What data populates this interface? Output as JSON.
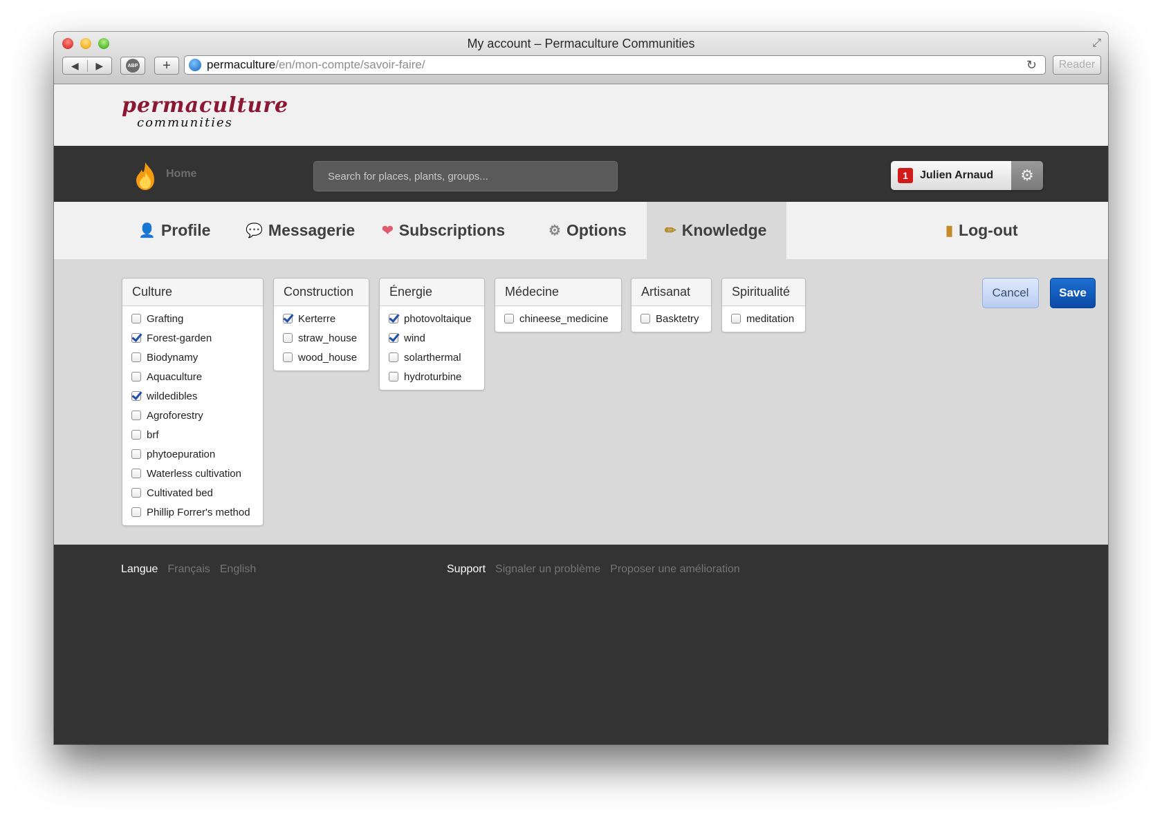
{
  "window": {
    "title": "My account – Permaculture Communities"
  },
  "browser": {
    "url_host": "permaculture",
    "url_path": "/en/mon-compte/savoir-faire/",
    "reader_label": "Reader",
    "abp_label": "ABP",
    "back_glyph": "◀",
    "forward_glyph": "▶",
    "add_glyph": "+",
    "reload_glyph": "↻"
  },
  "logo": {
    "top": "permaculture",
    "bottom": "communities"
  },
  "nav": {
    "home_label": "Home",
    "search_placeholder": "Search for places, plants, groups...",
    "user_name": "Julien Arnaud",
    "notification_count": "1"
  },
  "tabs": [
    {
      "label": "Profile",
      "icon": "user-icon"
    },
    {
      "label": "Messagerie",
      "icon": "chat-icon"
    },
    {
      "label": "Subscriptions",
      "icon": "heart-icon"
    },
    {
      "label": "Options",
      "icon": "gear-icon"
    },
    {
      "label": "Knowledge",
      "icon": "wand-icon",
      "active": true
    },
    {
      "label": "Log-out",
      "icon": "door-icon"
    }
  ],
  "categories": [
    {
      "title": "Culture",
      "items": [
        {
          "label": "Grafting",
          "checked": false
        },
        {
          "label": "Forest-garden",
          "checked": true
        },
        {
          "label": "Biodynamy",
          "checked": false
        },
        {
          "label": "Aquaculture",
          "checked": false
        },
        {
          "label": "wildedibles",
          "checked": true
        },
        {
          "label": "Agroforestry",
          "checked": false
        },
        {
          "label": "brf",
          "checked": false
        },
        {
          "label": "phytoepuration",
          "checked": false
        },
        {
          "label": "Waterless cultivation",
          "checked": false
        },
        {
          "label": "Cultivated bed",
          "checked": false
        },
        {
          "label": "Phillip Forrer's method",
          "checked": false
        }
      ]
    },
    {
      "title": "Construction",
      "items": [
        {
          "label": "Kerterre",
          "checked": true
        },
        {
          "label": "straw_house",
          "checked": false
        },
        {
          "label": "wood_house",
          "checked": false
        }
      ]
    },
    {
      "title": "Énergie",
      "items": [
        {
          "label": "photovoltaique",
          "checked": true
        },
        {
          "label": "wind",
          "checked": true
        },
        {
          "label": "solarthermal",
          "checked": false
        },
        {
          "label": "hydroturbine",
          "checked": false
        }
      ]
    },
    {
      "title": "Médecine",
      "items": [
        {
          "label": "chineese_medicine",
          "checked": false
        }
      ]
    },
    {
      "title": "Artisanat",
      "items": [
        {
          "label": "Basktetry",
          "checked": false
        }
      ]
    },
    {
      "title": "Spiritualité",
      "items": [
        {
          "label": "meditation",
          "checked": false
        }
      ]
    }
  ],
  "actions": {
    "cancel": "Cancel",
    "save": "Save"
  },
  "footer": {
    "langue_label": "Langue",
    "lang_fr": "Français",
    "lang_en": "English",
    "support_label": "Support",
    "report_problem": "Signaler un problème",
    "suggest_improvement": "Proposer une amélioration"
  },
  "colors": {
    "brand": "#8a1734",
    "dark_bg": "#333333",
    "save_blue": "#0b4aa6",
    "notification_red": "#d11a1a"
  }
}
